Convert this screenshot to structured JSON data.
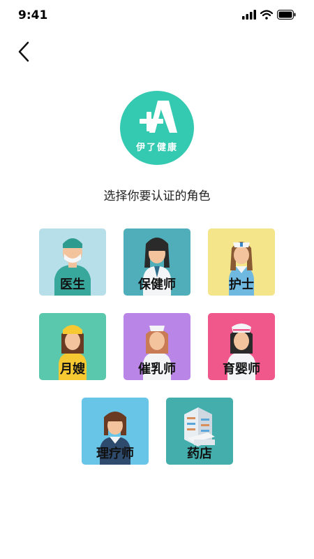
{
  "status": {
    "time": "9:41"
  },
  "logo": {
    "text": "伊了健康",
    "color": "#34c9b1"
  },
  "prompt": "选择你要认证的角色",
  "roles": [
    {
      "label": "医生",
      "color": "#b7dfe9",
      "icon": "doctor-icon"
    },
    {
      "label": "保健师",
      "color": "#4faeb9",
      "icon": "health-worker-icon"
    },
    {
      "label": "护士",
      "color": "#f4e48a",
      "icon": "nurse-icon"
    },
    {
      "label": "月嫂",
      "color": "#5ac8ad",
      "icon": "maternity-matron-icon"
    },
    {
      "label": "催乳师",
      "color": "#b986e8",
      "icon": "lactation-consultant-icon"
    },
    {
      "label": "育婴师",
      "color": "#f0578b",
      "icon": "nanny-icon"
    },
    {
      "label": "理疗师",
      "color": "#69c5e8",
      "icon": "physiotherapist-icon"
    },
    {
      "label": "药店",
      "color": "#43aeac",
      "icon": "pharmacy-icon"
    }
  ]
}
